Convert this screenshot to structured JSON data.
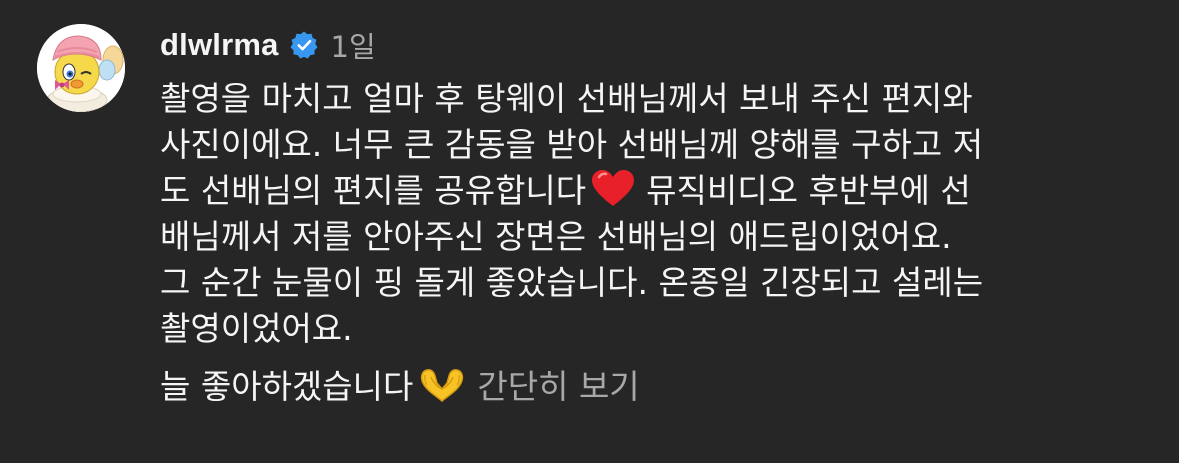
{
  "comment": {
    "author": {
      "username": "dlwlrma",
      "verified_icon": "verified-badge-icon",
      "avatar_icon": "tweety-bird-avatar"
    },
    "time": "1일",
    "caption_lines": [
      "촬영을 마치고 얼마 후 탕웨이 선배님께서 보내 주신 편지와",
      "사진이에요. 너무 큰 감동을 받아 선배님께 양해를 구하고 저",
      "도 선배님의 편지를 공유합니다",
      "뮤직비디오 후반부에 선",
      "배님께서 저를 안아주신 장면은 선배님의 애드립이었어요.",
      "그 순간 눈물이 핑 돌게 좋았습니다. 온종일 긴장되고 설레는",
      "촬영이었어요."
    ],
    "heart_icon": "red-heart-emoji",
    "closing_line": "늘 좋아하겠습니다",
    "closing_icon": "heart-hands-emoji",
    "show_less_label": "간단히 보기"
  },
  "colors": {
    "background": "#262626",
    "text_primary": "#f5f5f5",
    "text_secondary": "#a8a8a8",
    "verified_blue": "#3897f0",
    "heart_red": "#e8202a",
    "heart_hands_yellow": "#f7c325"
  }
}
